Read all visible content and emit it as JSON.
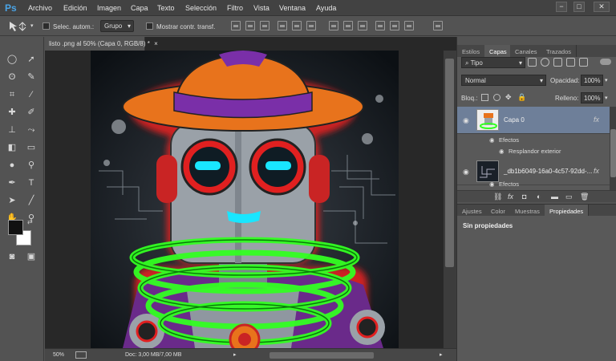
{
  "app": {
    "logo": "Ps"
  },
  "menu": [
    "Archivo",
    "Edición",
    "Imagen",
    "Capa",
    "Texto",
    "Selección",
    "Filtro",
    "Vista",
    "Ventana",
    "Ayuda"
  ],
  "window_controls": [
    "−",
    "□",
    "✕"
  ],
  "options": {
    "auto_select_label": "Selec. autom.:",
    "auto_select_value": "Grupo",
    "transform_label": "Mostrar contr. transf."
  },
  "document": {
    "tab_title": "listo .png al 50% (Capa 0, RGB/8) *",
    "tab_close": "×",
    "zoom": "50%",
    "doc_info": "Doc: 3,00 MB/7,00 MB"
  },
  "layers_panel": {
    "tabs": [
      "Estilos",
      "Capas",
      "Canales",
      "Trazados"
    ],
    "active_tab": "Capas",
    "filter_kind": "Tipo",
    "blend_mode": "Normal",
    "opacity_label": "Opacidad:",
    "opacity_value": "100%",
    "lock_label": "Bloq.:",
    "fill_label": "Relleno:",
    "fill_value": "100%",
    "layers": [
      {
        "name": "Capa 0",
        "fx": "fx",
        "effects_label": "Efectos",
        "effect": "Resplandor exterior"
      },
      {
        "name": "_db1b6049-16a0-4c57-92dd-...",
        "fx": "fx",
        "effects_label": "Efectos"
      }
    ]
  },
  "properties_panel": {
    "tabs": [
      "Ajustes",
      "Color",
      "Muestras",
      "Propiedades"
    ],
    "active_tab": "Propiedades",
    "empty_text": "Sin propiedades"
  },
  "colors": {
    "accent": "#4aa4e6",
    "hat": "#e8731c",
    "hat_band": "#7a2fa8",
    "glow_red": "#e02020",
    "coil_green": "#33ff22",
    "eye_cyan": "#19e6ff",
    "robot_gray": "#9aa1a8"
  }
}
